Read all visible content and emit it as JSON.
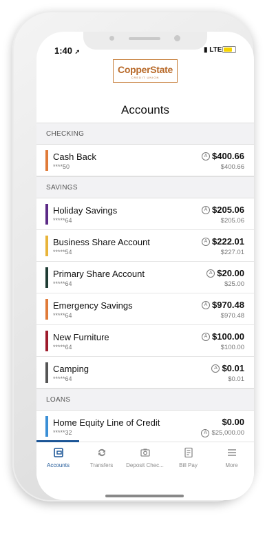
{
  "status": {
    "time": "1:40",
    "signal": "LTE"
  },
  "logo": {
    "line1": "CopperState",
    "line2": "CREDIT UNION"
  },
  "page_title": "Accounts",
  "sections": [
    {
      "title": "CHECKING",
      "accounts": [
        {
          "name": "Cash Back",
          "number": "****50",
          "balance": "$400.66",
          "available": "$400.66",
          "color": "#e07b39",
          "indicator": "A",
          "indicator_on": "balance"
        }
      ]
    },
    {
      "title": "SAVINGS",
      "accounts": [
        {
          "name": "Holiday Savings",
          "number": "*****64",
          "balance": "$205.06",
          "available": "$205.06",
          "color": "#5b2a86",
          "indicator": "A",
          "indicator_on": "balance"
        },
        {
          "name": "Business Share Account",
          "number": "*****54",
          "balance": "$222.01",
          "available": "$227.01",
          "color": "#e8b43a",
          "indicator": "A",
          "indicator_on": "balance"
        },
        {
          "name": "Primary Share Account",
          "number": "*****64",
          "balance": "$20.00",
          "available": "$25.00",
          "color": "#1f3c34",
          "indicator": "A",
          "indicator_on": "balance"
        },
        {
          "name": "Emergency Savings",
          "number": "*****64",
          "balance": "$970.48",
          "available": "$970.48",
          "color": "#e07b39",
          "indicator": "A",
          "indicator_on": "balance"
        },
        {
          "name": "New Furniture",
          "number": "*****64",
          "balance": "$100.00",
          "available": "$100.00",
          "color": "#9e1b2b",
          "indicator": "A",
          "indicator_on": "balance"
        },
        {
          "name": "Camping",
          "number": "*****64",
          "balance": "$0.01",
          "available": "$0.01",
          "color": "#555555",
          "indicator": "A",
          "indicator_on": "balance"
        }
      ]
    },
    {
      "title": "LOANS",
      "accounts": [
        {
          "name": "Home Equity Line of Credit",
          "number": "*****32",
          "balance": "$0.00",
          "available": "$25,000.00",
          "color": "#3a8fd6",
          "indicator": "A",
          "indicator_on": "available"
        }
      ]
    }
  ],
  "tabs": [
    {
      "label": "Accounts",
      "icon": "wallet-icon",
      "active": true
    },
    {
      "label": "Transfers",
      "icon": "transfer-icon",
      "active": false
    },
    {
      "label": "Deposit Chec...",
      "icon": "camera-icon",
      "active": false
    },
    {
      "label": "Bill Pay",
      "icon": "bill-icon",
      "active": false
    },
    {
      "label": "More",
      "icon": "menu-icon",
      "active": false
    }
  ],
  "colors": {
    "accent": "#1b5596",
    "brand": "#b86a2a"
  }
}
